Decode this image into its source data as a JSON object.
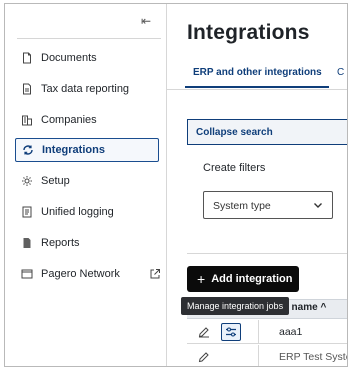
{
  "sidebar": {
    "items": [
      {
        "label": "Documents",
        "icon": "document-icon"
      },
      {
        "label": "Tax data reporting",
        "icon": "report-doc-icon"
      },
      {
        "label": "Companies",
        "icon": "building-icon"
      },
      {
        "label": "Integrations",
        "icon": "integrations-icon",
        "active": true
      },
      {
        "label": "Setup",
        "icon": "gear-icon"
      },
      {
        "label": "Unified logging",
        "icon": "log-icon"
      },
      {
        "label": "Reports",
        "icon": "reports-icon"
      },
      {
        "label": "Pagero Network",
        "icon": "network-icon"
      }
    ],
    "collapse_glyph": "⇤"
  },
  "main": {
    "title": "Integrations",
    "tabs": [
      {
        "label": "ERP and other integrations",
        "active": true
      },
      {
        "label": "C"
      }
    ],
    "collapse_search": "Collapse search",
    "filters_label": "Create filters",
    "filter_select": {
      "value": "System type"
    },
    "add_button": "Add integration",
    "tooltip": "Manage integration jobs",
    "table": {
      "name_header": "tem name",
      "rows": [
        {
          "name": "aaa1"
        },
        {
          "name": "ERP Test Syste"
        }
      ]
    }
  },
  "colors": {
    "accent": "#0f3e7a",
    "button_bg": "#0b0b0b",
    "tooltip_bg": "#2d2f33"
  }
}
